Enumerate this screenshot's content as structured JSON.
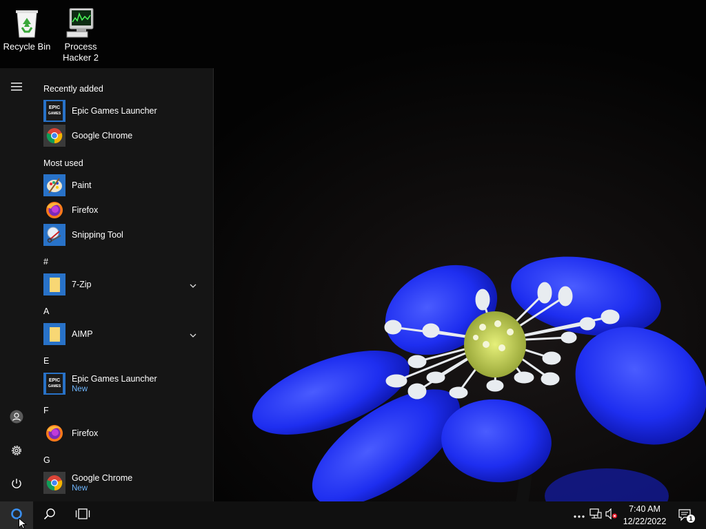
{
  "desktop": {
    "icons": [
      {
        "label": "Recycle Bin"
      },
      {
        "label": "Process Hacker 2"
      }
    ]
  },
  "start_menu": {
    "recently_added": {
      "header": "Recently added",
      "items": [
        {
          "label": "Epic Games Launcher",
          "icon": "epic-games-icon"
        },
        {
          "label": "Google Chrome",
          "icon": "chrome-icon"
        }
      ]
    },
    "most_used": {
      "header": "Most used",
      "items": [
        {
          "label": "Paint",
          "icon": "paint-icon"
        },
        {
          "label": "Firefox",
          "icon": "firefox-icon"
        },
        {
          "label": "Snipping Tool",
          "icon": "snipping-tool-icon"
        }
      ]
    },
    "sections": [
      {
        "letter": "#",
        "items": [
          {
            "label": "7-Zip",
            "icon": "folder-icon",
            "expandable": true
          }
        ]
      },
      {
        "letter": "A",
        "items": [
          {
            "label": "AIMP",
            "icon": "folder-icon",
            "expandable": true
          }
        ]
      },
      {
        "letter": "E",
        "items": [
          {
            "label": "Epic Games Launcher",
            "badge": "New",
            "icon": "epic-games-icon"
          }
        ]
      },
      {
        "letter": "F",
        "items": [
          {
            "label": "Firefox",
            "icon": "firefox-icon"
          }
        ]
      },
      {
        "letter": "G",
        "items": [
          {
            "label": "Google Chrome",
            "badge": "New",
            "icon": "chrome-icon"
          }
        ]
      }
    ],
    "epic_logo_text": [
      "EPIC",
      "GAMES"
    ]
  },
  "taskbar": {
    "time": "7:40 AM",
    "date": "12/22/2022",
    "notification_count": "1"
  },
  "colors": {
    "accent": "#0078d7",
    "new_badge": "#6fb7ff",
    "taskbar": "#101010",
    "flower": "#1a2cff"
  }
}
